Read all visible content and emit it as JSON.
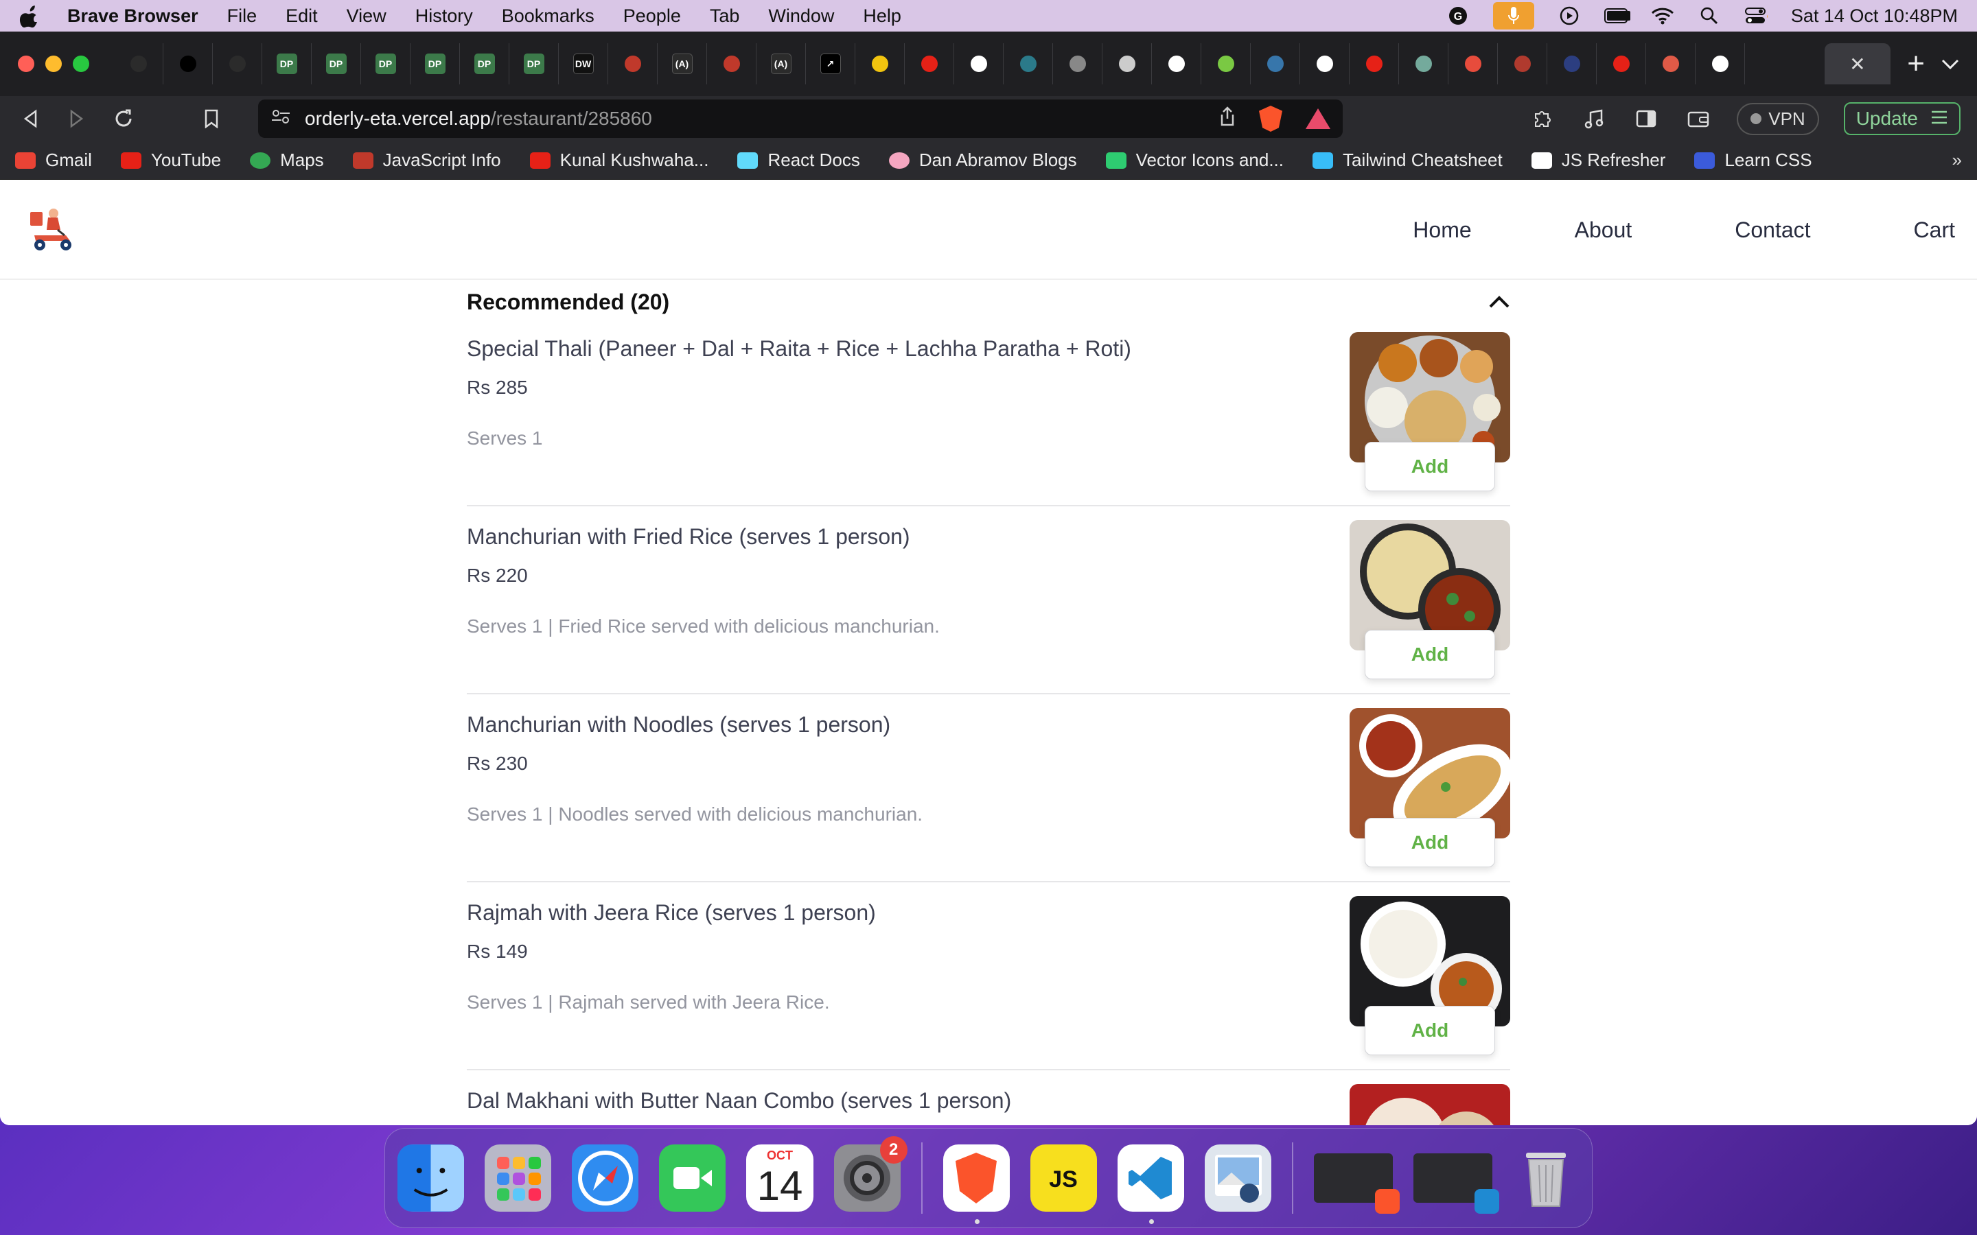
{
  "menubar": {
    "app_name": "Brave Browser",
    "items": [
      "File",
      "Edit",
      "View",
      "History",
      "Bookmarks",
      "People",
      "Tab",
      "Window",
      "Help"
    ],
    "clock": "Sat 14 Oct  10:48PM"
  },
  "browser": {
    "tabs": [
      {
        "icon": "framer-icon",
        "label": "",
        "color": "#2b2b2b"
      },
      {
        "icon": "medium-icon",
        "label": "",
        "color": "#000000"
      },
      {
        "icon": "loader-icon",
        "label": "",
        "color": "#2b2b2b"
      },
      {
        "icon": "dp-icon",
        "label": "DP",
        "color": "#3c7a4a"
      },
      {
        "icon": "dp-icon",
        "label": "DP",
        "color": "#3c7a4a"
      },
      {
        "icon": "dp-icon",
        "label": "DP",
        "color": "#3c7a4a"
      },
      {
        "icon": "dp-icon",
        "label": "DP",
        "color": "#3c7a4a"
      },
      {
        "icon": "dp-icon",
        "label": "DP",
        "color": "#3c7a4a"
      },
      {
        "icon": "dp-icon",
        "label": "DP",
        "color": "#3c7a4a"
      },
      {
        "icon": "dw-icon",
        "label": "DW",
        "color": "#111111"
      },
      {
        "icon": "js-info-icon",
        "label": "",
        "color": "#c0392b"
      },
      {
        "icon": "react-a-icon",
        "label": "(A)",
        "color": "#2b2b2b"
      },
      {
        "icon": "js-info-icon",
        "label": "",
        "color": "#c0392b"
      },
      {
        "icon": "react-a-icon",
        "label": "(A)",
        "color": "#2b2b2b"
      },
      {
        "icon": "arrow-icon",
        "label": "↗",
        "color": "#000000"
      },
      {
        "icon": "note-icon",
        "label": "",
        "color": "#f1c40f"
      },
      {
        "icon": "youtube-icon",
        "label": "",
        "color": "#e62117"
      },
      {
        "icon": "github-icon",
        "label": "",
        "color": "#ffffff"
      },
      {
        "icon": "wave-icon",
        "label": "",
        "color": "#2b7a8a"
      },
      {
        "icon": "ghost-icon",
        "label": "",
        "color": "#888888"
      },
      {
        "icon": "globe-icon",
        "label": "",
        "color": "#cccccc"
      },
      {
        "icon": "github-icon",
        "label": "",
        "color": "#ffffff"
      },
      {
        "icon": "leaf-icon",
        "label": "",
        "color": "#7ac943"
      },
      {
        "icon": "python-icon",
        "label": "",
        "color": "#3776ab"
      },
      {
        "icon": "github-icon",
        "label": "",
        "color": "#ffffff"
      },
      {
        "icon": "youtube-icon",
        "label": "",
        "color": "#e62117"
      },
      {
        "icon": "chatgpt-icon",
        "label": "",
        "color": "#74aa9c"
      },
      {
        "icon": "record-icon",
        "label": "",
        "color": "#e74c3c"
      },
      {
        "icon": "dot-icon",
        "label": "",
        "color": "#b03a2e"
      },
      {
        "icon": "circle-icon",
        "label": "",
        "color": "#2c3e80"
      },
      {
        "icon": "youtube-icon",
        "label": "",
        "color": "#e62117"
      },
      {
        "icon": "octopus-icon",
        "label": "",
        "color": "#e05a47"
      },
      {
        "icon": "github-icon",
        "label": "",
        "color": "#ffffff"
      }
    ],
    "url": {
      "host": "orderly-eta.vercel.app",
      "path": "/restaurant/285860"
    },
    "vpn_label": "VPN",
    "update_label": "Update",
    "bookmarks": [
      {
        "label": "Gmail",
        "icon": "gmail-icon",
        "color": "#ea4335"
      },
      {
        "label": "YouTube",
        "icon": "youtube-icon",
        "color": "#e62117"
      },
      {
        "label": "Maps",
        "icon": "maps-icon",
        "color": "#34a853"
      },
      {
        "label": "JavaScript Info",
        "icon": "js-info-icon",
        "color": "#c0392b"
      },
      {
        "label": "Kunal Kushwaha...",
        "icon": "youtube-icon",
        "color": "#e62117"
      },
      {
        "label": "React Docs",
        "icon": "react-icon",
        "color": "#61dafb"
      },
      {
        "label": "Dan Abramov Blogs",
        "icon": "avatar-icon",
        "color": "#f4a6c0"
      },
      {
        "label": "Vector Icons and...",
        "icon": "vector-icon",
        "color": "#2ecc71"
      },
      {
        "label": "Tailwind Cheatsheet",
        "icon": "tailwind-icon",
        "color": "#38bdf8"
      },
      {
        "label": "JS Refresher",
        "icon": "js-refresher-icon",
        "color": "#ffffff"
      },
      {
        "label": "Learn CSS",
        "icon": "css-icon",
        "color": "#3b5bdb"
      }
    ],
    "bookmarks_more": "»"
  },
  "site": {
    "nav": [
      "Home",
      "About",
      "Contact",
      "Cart"
    ],
    "section_title": "Recommended (20)",
    "add_label": "Add",
    "items": [
      {
        "name": "Special Thali (Paneer + Dal + Raita + Rice + Lachha Paratha + Roti)",
        "price": "Rs 285",
        "desc": "Serves 1",
        "image": "thali"
      },
      {
        "name": "Manchurian with Fried Rice (serves 1 person)",
        "price": "Rs 220",
        "desc": "Serves 1 | Fried Rice served with delicious manchurian.",
        "image": "fried-rice"
      },
      {
        "name": "Manchurian with Noodles (serves 1 person)",
        "price": "Rs 230",
        "desc": "Serves 1 | Noodles served with delicious manchurian.",
        "image": "noodles"
      },
      {
        "name": "Rajmah with Jeera Rice (serves 1 person)",
        "price": "Rs 149",
        "desc": "Serves 1 | Rajmah served with Jeera Rice.",
        "image": "rajmah"
      },
      {
        "name": "Dal Makhani with Butter Naan Combo (serves 1 person)",
        "price": "",
        "desc": "",
        "image": "dal-makhani"
      }
    ],
    "colors": {
      "add_green": "#60b246",
      "text_dark": "#3e4152",
      "text_muted": "#93959f"
    }
  },
  "dock": {
    "apps": [
      {
        "name": "finder",
        "icon": "finder-icon",
        "color": "#3b8cf0",
        "running": true
      },
      {
        "name": "launchpad",
        "icon": "launchpad-icon",
        "color": "#b8b8c8",
        "running": false
      },
      {
        "name": "safari",
        "icon": "safari-icon",
        "color": "#2f8cf0",
        "running": false
      },
      {
        "name": "facetime",
        "icon": "facetime-icon",
        "color": "#34c759",
        "running": false
      },
      {
        "name": "calendar",
        "icon": "calendar-icon",
        "color": "#ffffff",
        "running": false,
        "month": "OCT",
        "day": "14"
      },
      {
        "name": "system-settings",
        "icon": "settings-icon",
        "color": "#8e8e93",
        "running": false,
        "badge": "2"
      },
      {
        "name": "brave",
        "icon": "brave-icon",
        "color": "#ffffff",
        "running": true
      },
      {
        "name": "js-playground",
        "icon": "js-icon",
        "color": "#f7df1e",
        "running": false
      },
      {
        "name": "vscode",
        "icon": "vscode-icon",
        "color": "#ffffff",
        "running": true
      },
      {
        "name": "preview",
        "icon": "preview-icon",
        "color": "#dfe6ee",
        "running": false
      }
    ]
  }
}
